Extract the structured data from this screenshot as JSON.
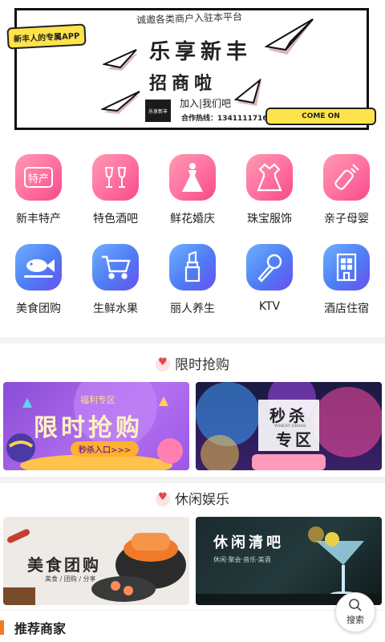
{
  "banner": {
    "tag_left": "新丰人的专属APP",
    "slogan": "诚邀各类商户入驻本平台",
    "headline_line1": "乐享新丰",
    "headline_line2": "招商啦",
    "logo_text": "乐享新丰",
    "join_text": "加入|我们吧",
    "hotline": "合作热线：13411117165",
    "tag_right": "COME ON"
  },
  "categories": [
    {
      "label": "新丰特产",
      "icon": "specialty-icon",
      "color": "pink"
    },
    {
      "label": "特色酒吧",
      "icon": "wine-glasses-icon",
      "color": "pink"
    },
    {
      "label": "鲜花婚庆",
      "icon": "wedding-dress-icon",
      "color": "pink"
    },
    {
      "label": "珠宝服饰",
      "icon": "dress-icon",
      "color": "pink"
    },
    {
      "label": "亲子母婴",
      "icon": "baby-bottle-icon",
      "color": "pink"
    },
    {
      "label": "美食团购",
      "icon": "fish-dish-icon",
      "color": "blue"
    },
    {
      "label": "生鲜水果",
      "icon": "shopping-cart-icon",
      "color": "blue"
    },
    {
      "label": "丽人养生",
      "icon": "lipstick-icon",
      "color": "blue"
    },
    {
      "label": "KTV",
      "icon": "microphone-icon",
      "color": "blue"
    },
    {
      "label": "酒店住宿",
      "icon": "hotel-icon",
      "color": "blue"
    }
  ],
  "flash_sale": {
    "title": "限时抢购",
    "card1": {
      "badge": "福利专区",
      "headline": "限时抢购",
      "cta": "秒杀入口>>>"
    },
    "card2": {
      "headline_top": "秒杀",
      "headline_bottom": "专区",
      "sub": "WHEAT GRASS"
    }
  },
  "leisure": {
    "title": "休闲娱乐",
    "card1": {
      "headline": "美食团购",
      "sub": "美食 / 团购 / 分享"
    },
    "card2": {
      "headline": "休闲清吧",
      "sub": "休闲·聚会·音乐·美酒"
    }
  },
  "search_fab": {
    "label": "搜索"
  },
  "recommended": {
    "title": "推荐商家"
  },
  "colors": {
    "accent": "#f37a22",
    "pink": "#ff6fa0",
    "blue": "#4e7cf4",
    "tag_yellow": "#ffe34a"
  }
}
